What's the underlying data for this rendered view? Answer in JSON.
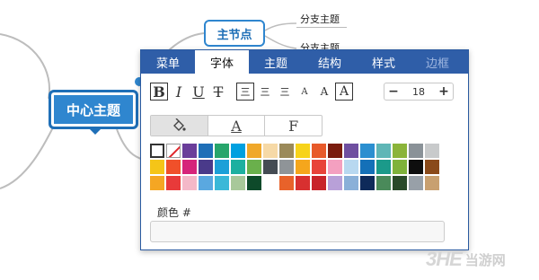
{
  "mindmap": {
    "central_topic": "中心主题",
    "main_node": "主节点",
    "subtopic_1": "分支主题",
    "subtopic_2": "分支主题"
  },
  "panel": {
    "tabs": [
      {
        "label": "菜单"
      },
      {
        "label": "字体"
      },
      {
        "label": "主题"
      },
      {
        "label": "结构"
      },
      {
        "label": "样式"
      },
      {
        "label": "边框"
      }
    ],
    "active_tab": "字体",
    "font_toolbar": {
      "bold": "B",
      "italic": "I",
      "underline": "U",
      "strike": "T",
      "align_left": "三",
      "align_center": "三",
      "align_right": "三",
      "case_small": "A",
      "case_normal": "A",
      "case_boxed": "A"
    },
    "font_size": {
      "minus": "−",
      "value": "18",
      "plus": "+"
    },
    "style_tabs": {
      "fill": "",
      "text": "A",
      "font": "F"
    },
    "color_label": "颜色 #",
    "color_value": ""
  },
  "palette": [
    [
      "sel",
      "none",
      "#6a3d9a",
      "#1f6fb7",
      "#27a56b",
      "#00a0e0",
      "#f0a82a",
      "#f6d9a6",
      "#9b8a5a",
      "#f7d31a",
      "#e85a2a",
      "#7a1c0e",
      "#6f4fa0",
      "#2b8fd0",
      "#5fb6b6",
      "#8bb43a",
      "#8a9298",
      "#c8cacb"
    ],
    [
      "#f5c518",
      "#f0502a",
      "#d6247a",
      "#4a3a8a",
      "#1ca0d8",
      "#1db0a0",
      "#6ab04c",
      "#444b53",
      "#8f9498",
      "#f5a61c",
      "#e8433a",
      "#f4a0c0",
      "#b8d8f0",
      "#1470b8",
      "#1b9a8a",
      "#7fb23a",
      "#0e0e0e",
      "#8a4a1a"
    ],
    [
      "#f5a623",
      "#e83a3a",
      "#f4b8c8",
      "#5aa8e0",
      "#3ab8d8",
      "#a8c89a",
      "#0e4a2a",
      "blank",
      "#e8622a",
      "#d83030",
      "#c8242a",
      "#b8a0d8",
      "#8ab0d8",
      "#0e2a5a",
      "#4a8a5a",
      "#2a4a2a",
      "#98a0a8",
      "#c8a070"
    ]
  ],
  "watermark": {
    "logo": "3HE",
    "text": "当游网"
  }
}
